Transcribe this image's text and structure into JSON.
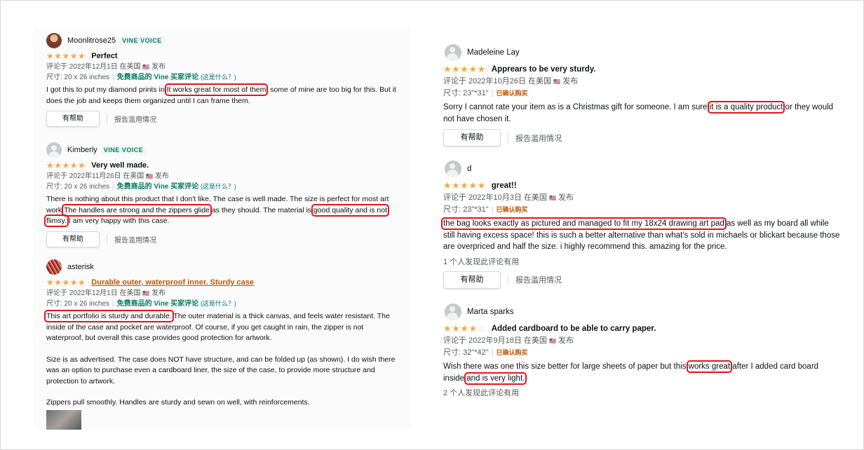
{
  "left": {
    "reviews": [
      {
        "name": "Moonlitrose25",
        "badge": "VINE VOICE",
        "stars": "★★★★★",
        "title": "Perfect",
        "date": "评论于 2022年12月1日 在美国",
        "flag": "🇺🇸",
        "posted": "发布",
        "size": "尺寸: 20 x 26 inches",
        "vine_label": "免费商品的 Vine 买家评论",
        "what": "(这是什么？)",
        "body_a": "I got this to put my diamond prints in.",
        "body_hl": "It works great for most of them",
        "body_b": ", some of mine are too big for this. But it does the job and keeps them organized until I can frame them.",
        "helpful": "有帮助",
        "report": "报告滥用情况"
      },
      {
        "name": "Kimberly",
        "badge": "VINE VOICE",
        "stars": "★★★★★",
        "title": "Very well made.",
        "date": "评论于 2022年11月26日 在美国",
        "flag": "🇺🇸",
        "posted": "发布",
        "size": "尺寸: 20 x 26 inches",
        "vine_label": "免费商品的 Vine 买家评论",
        "what": "(这是什么？)",
        "body_a": "There is nothing about this product that I don't like. The case is well made. The size is perfect for most art work.",
        "body_hl1": "The handles are strong and the zippers glide",
        "body_b": " as they should. The material is ",
        "body_hl2": "good quality and is not",
        "body_hl3": "flimsy.",
        "body_c": " I am very happy with this case.",
        "helpful": "有帮助",
        "report": "报告滥用情况"
      },
      {
        "name": "asterisk",
        "stars": "★★★★★",
        "title": "Durable outer, waterproof inner. Sturdy case",
        "date": "评论于 2022年12月1日 在美国",
        "flag": "🇺🇸",
        "posted": "发布",
        "size": "尺寸: 20 x 26 inches",
        "vine_label": "免费商品的 Vine 买家评论",
        "what": "(这是什么？)",
        "body_hl": "This art portfolio is sturdy and durable.",
        "body_a": " The outer material is a thick canvas, and feels water resistant. The inside of the case and pocket are waterproof. Of course, if you get caught in rain, the zipper is not waterproof, but overall this case provides good protection for artwork.",
        "body_p2": "Size is as advertised. The case does NOT have structure, and can be folded up (as shown). I do wish there was an option to purchase even a cardboard liner, the size of the case, to provide more structure and protection to artwork.",
        "body_p3": "Zippers pull smoothly. Handles are sturdy and sewn on well, with reinforcements."
      }
    ]
  },
  "right": {
    "reviews": [
      {
        "name": "Madeleine Lay",
        "stars": "★★★★★",
        "title": "Apprears to be very sturdy.",
        "date": "评论于 2022年10月26日 在美国",
        "flag": "🇺🇸",
        "posted": "发布",
        "size": "尺寸: 23\"*31\"",
        "verified": "已确认购买",
        "body_a": "Sorry I cannot rate your item as is a Christmas gift for someone. I am sure ",
        "body_hl": "it is a quality product",
        "body_b": " or they would not have chosen it.",
        "helpful": "有帮助",
        "report": "报告滥用情况"
      },
      {
        "name": "d",
        "stars": "★★★★★",
        "title": "great!!",
        "date": "评论于 2022年10月3日 在美国",
        "flag": "🇺🇸",
        "posted": "发布",
        "size": "尺寸: 23\"*31\"",
        "verified": "已确认购买",
        "body_hl": "the bag looks exactly as pictured and managed to fit my 18x24 drawing art pad",
        "body_a": " as well as my board all while still having excess space! this is such a better alternative than what's sold in michaels or blickart because those are overpriced and half the size. i highly recommend this. amazing for the price.",
        "found": "1 个人发现此评论有用",
        "helpful": "有帮助",
        "report": "报告滥用情况"
      },
      {
        "name": "Marta sparks",
        "stars_on": "★★★★",
        "stars_off": "☆",
        "title": "Added cardboard to be able to carry paper.",
        "date": "评论于 2022年9月18日 在美国",
        "flag": "🇺🇸",
        "posted": "发布",
        "size": "尺寸: 32\"*42\"",
        "verified": "已确认购买",
        "body_a": "Wish there was one this size better for large sheets of paper but this ",
        "body_hl1": "works great",
        "body_b": " after I added card board inside ",
        "body_hl2": "and is very light.",
        "found": "2 个人发现此评论有用"
      }
    ]
  }
}
